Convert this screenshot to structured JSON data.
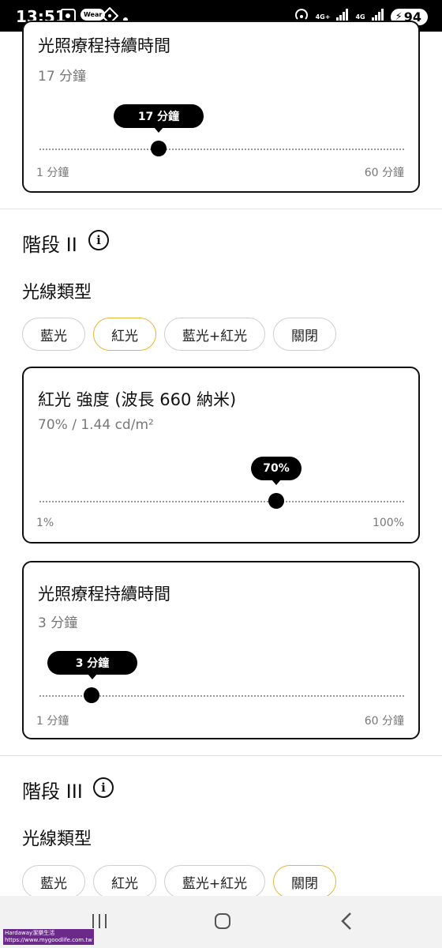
{
  "status_bar": {
    "time": "13:51",
    "battery": "94",
    "net1": "4G+",
    "net2": "4G",
    "wear_label": "Wear"
  },
  "top_card": {
    "title": "光照療程持續時間",
    "value_text": "17 分鐘",
    "tooltip": "17 分鐘",
    "min_label": "1 分鐘",
    "max_label": "60 分鐘",
    "slider_value": 17,
    "slider_min": 1,
    "slider_max": 60
  },
  "stage2": {
    "title": "階段 II",
    "light_type_heading": "光線類型",
    "chips": [
      {
        "label": "藍光",
        "selected": false
      },
      {
        "label": "紅光",
        "selected": true
      },
      {
        "label": "藍光+紅光",
        "selected": false
      },
      {
        "label": "關閉",
        "selected": false
      }
    ],
    "intensity_card": {
      "title": "紅光 強度 (波長 660 納米)",
      "value_text": "70% / 1.44 cd/m²",
      "tooltip": "70%",
      "min_label": "1%",
      "max_label": "100%",
      "slider_value": 70,
      "slider_min": 1,
      "slider_max": 100
    },
    "duration_card": {
      "title": "光照療程持續時間",
      "value_text": "3 分鐘",
      "tooltip": "3 分鐘",
      "min_label": "1 分鐘",
      "max_label": "60 分鐘",
      "slider_value": 3,
      "slider_min": 1,
      "slider_max": 60
    }
  },
  "stage3": {
    "title": "階段 III",
    "light_type_heading": "光線類型",
    "chips": [
      {
        "label": "藍光",
        "selected": false
      },
      {
        "label": "紅光",
        "selected": false
      },
      {
        "label": "藍光+紅光",
        "selected": false
      },
      {
        "label": "關閉",
        "selected": true
      }
    ]
  },
  "watermark": {
    "line1": "Hardaway潔樂生活",
    "line2": "https://www.mygoodlife.com.tw"
  },
  "colors": {
    "accent_selected": "#e4b53a",
    "knob": "#000000",
    "muted_text": "#777777"
  }
}
